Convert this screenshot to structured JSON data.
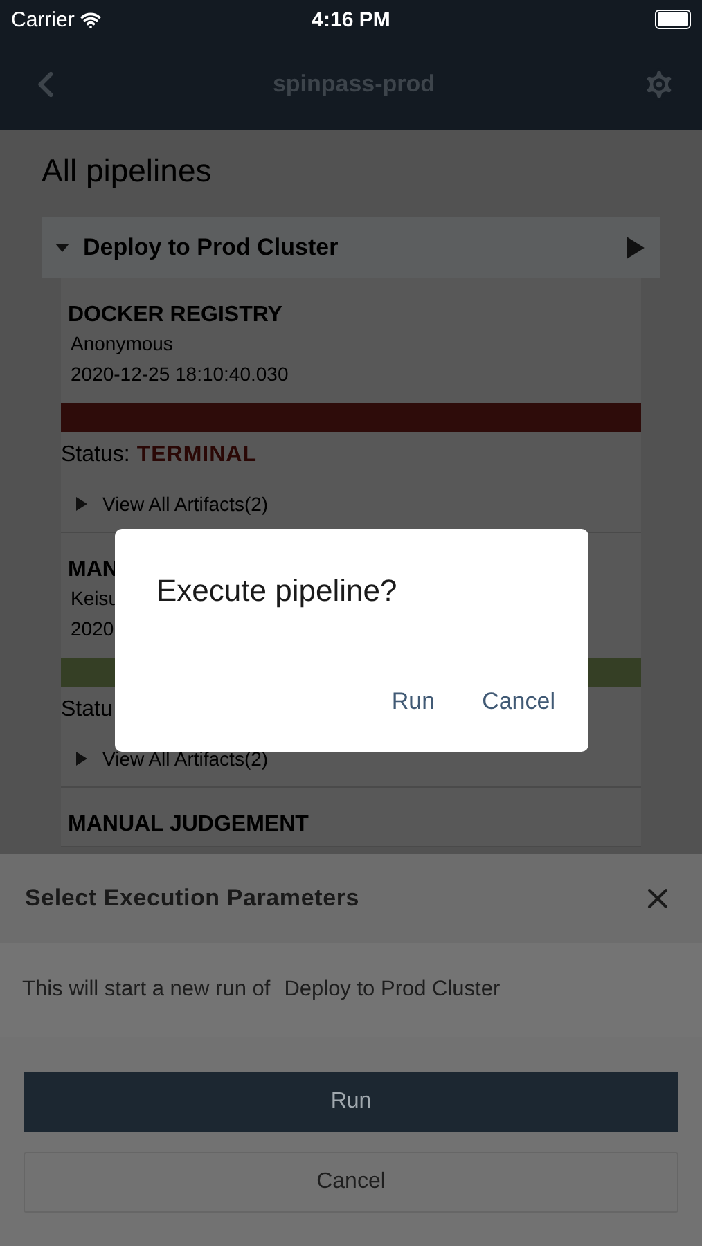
{
  "status_bar": {
    "carrier": "Carrier",
    "time": "4:16 PM"
  },
  "nav": {
    "title": "spinpass-prod"
  },
  "page": {
    "heading": "All pipelines"
  },
  "pipeline": {
    "name": "Deploy to Prod Cluster",
    "expanded": true
  },
  "stages": [
    {
      "title": "DOCKER REGISTRY",
      "user": "Anonymous",
      "time": "2020-12-25 18:10:40.030",
      "color": "#2e0c0a",
      "status_label": "Status:",
      "status": "TERMINAL",
      "artifacts": "View All Artifacts(2)"
    },
    {
      "title": "MAN",
      "user": "Keisu",
      "time": "2020",
      "color": "#353f25",
      "status_label": "Statu",
      "artifacts": "View All Artifacts(2)"
    },
    {
      "title": "MANUAL JUDGEMENT"
    }
  ],
  "sheet": {
    "title": "Select Execution Parameters",
    "message": "This will start a new run of",
    "pipeline": "Deploy to Prod Cluster",
    "buttons": [
      {
        "label": "Run",
        "kind": "primary"
      },
      {
        "label": "Cancel",
        "kind": "secondary"
      }
    ]
  },
  "dialog": {
    "title": "Execute pipeline?",
    "buttons": [
      "Run",
      "Cancel"
    ]
  }
}
